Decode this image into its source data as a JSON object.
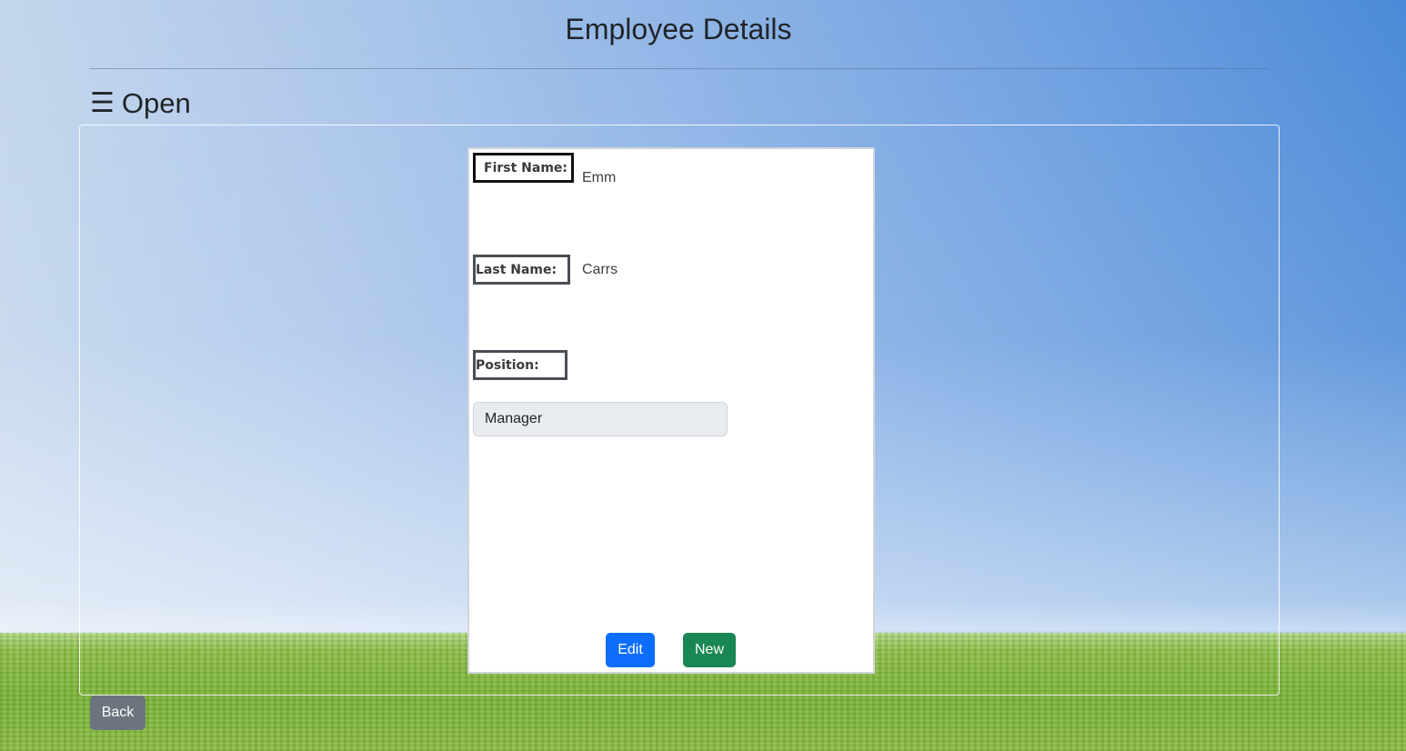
{
  "header": {
    "title": "Employee Details"
  },
  "menu": {
    "icon": "☰",
    "label": "Open"
  },
  "employee": {
    "first_name_label": "First Name:",
    "first_name_value": "Emm",
    "last_name_label": "Last Name:",
    "last_name_value": "Carrs",
    "position_label": "Position:",
    "position_value": "Manager"
  },
  "actions": {
    "edit_label": "Edit",
    "new_label": "New",
    "back_label": "Back"
  },
  "colors": {
    "edit_button": "#0d6efd",
    "new_button": "#198754",
    "back_button": "#6c757d"
  }
}
